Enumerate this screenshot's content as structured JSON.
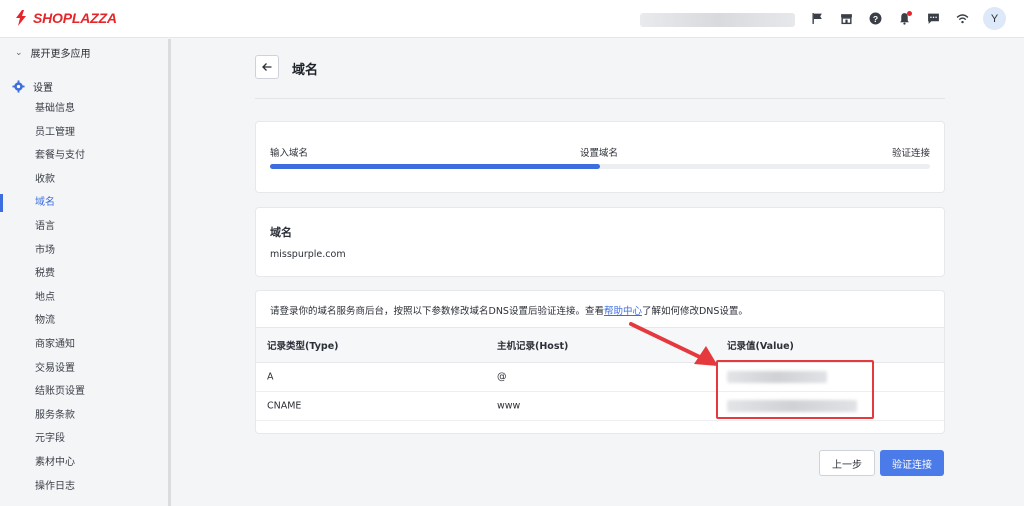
{
  "brand": {
    "name": "SHOPLAZZA",
    "color": "#e5252a"
  },
  "header": {
    "icons": [
      "flag-icon",
      "store-icon",
      "help-icon",
      "bell-icon",
      "message-icon",
      "wifi-icon"
    ],
    "avatar_initial": "Y"
  },
  "sidebar": {
    "expand_label": "展开更多应用",
    "settings_label": "设置",
    "items": [
      {
        "label": "基础信息"
      },
      {
        "label": "员工管理"
      },
      {
        "label": "套餐与支付"
      },
      {
        "label": "收款"
      },
      {
        "label": "域名",
        "active": true
      },
      {
        "label": "语言"
      },
      {
        "label": "市场"
      },
      {
        "label": "税费"
      },
      {
        "label": "地点"
      },
      {
        "label": "物流"
      },
      {
        "label": "商家通知"
      },
      {
        "label": "交易设置"
      },
      {
        "label": "结账页设置"
      },
      {
        "label": "服务条款"
      },
      {
        "label": "元字段"
      },
      {
        "label": "素材中心"
      },
      {
        "label": "操作日志"
      }
    ]
  },
  "page": {
    "title": "域名"
  },
  "steps": {
    "labels": [
      "输入域名",
      "设置域名",
      "验证连接"
    ],
    "progress": 0.5,
    "accent": "#3d6ee0"
  },
  "domain_card": {
    "title": "域名",
    "value": "misspurple.com"
  },
  "dns": {
    "note_before": "请登录你的域名服务商后台，按照以下参数修改域名DNS设置后验证连接。查看",
    "note_link": "帮助中心",
    "note_after": "了解如何修改DNS设置。",
    "columns": [
      "记录类型(Type)",
      "主机记录(Host)",
      "记录值(Value)"
    ],
    "rows": [
      {
        "type": "A",
        "host": "@"
      },
      {
        "type": "CNAME",
        "host": "www"
      }
    ]
  },
  "buttons": {
    "prev": "上一步",
    "verify": "验证连接"
  }
}
